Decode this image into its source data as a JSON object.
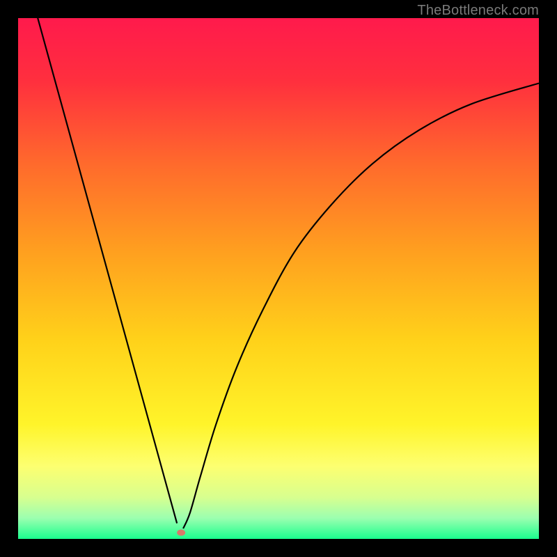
{
  "watermark": "TheBottleneck.com",
  "chart_data": {
    "type": "line",
    "title": "",
    "xlabel": "",
    "ylabel": "",
    "xlim": [
      0,
      100
    ],
    "ylim": [
      0,
      100
    ],
    "grid": false,
    "background_gradient": {
      "stops": [
        {
          "pos": 0.0,
          "color": "#ff1a4c"
        },
        {
          "pos": 0.12,
          "color": "#ff2f3e"
        },
        {
          "pos": 0.28,
          "color": "#ff6a2c"
        },
        {
          "pos": 0.45,
          "color": "#ffa01f"
        },
        {
          "pos": 0.62,
          "color": "#ffd21a"
        },
        {
          "pos": 0.78,
          "color": "#fff42a"
        },
        {
          "pos": 0.86,
          "color": "#fdff70"
        },
        {
          "pos": 0.92,
          "color": "#d8ff8f"
        },
        {
          "pos": 0.96,
          "color": "#9cffb0"
        },
        {
          "pos": 1.0,
          "color": "#1aff8e"
        }
      ]
    },
    "series": [
      {
        "name": "left-branch",
        "color": "#000000",
        "width": 2.2,
        "points": [
          {
            "x": 3.5,
            "y": 101
          },
          {
            "x": 30.5,
            "y": 3.0
          }
        ]
      },
      {
        "name": "right-branch",
        "color": "#000000",
        "width": 2.2,
        "points": [
          {
            "x": 31.7,
            "y": 2.0
          },
          {
            "x": 33.0,
            "y": 5.0
          },
          {
            "x": 35.0,
            "y": 12.0
          },
          {
            "x": 38.0,
            "y": 22.0
          },
          {
            "x": 42.0,
            "y": 33.0
          },
          {
            "x": 47.0,
            "y": 44.0
          },
          {
            "x": 53.0,
            "y": 55.0
          },
          {
            "x": 60.0,
            "y": 64.0
          },
          {
            "x": 68.0,
            "y": 72.0
          },
          {
            "x": 77.0,
            "y": 78.5
          },
          {
            "x": 87.0,
            "y": 83.5
          },
          {
            "x": 100.0,
            "y": 87.5
          }
        ]
      }
    ],
    "marker": {
      "x": 31.3,
      "y": 1.2,
      "rx": 6,
      "ry": 4.5,
      "color": "#d9796a"
    }
  }
}
